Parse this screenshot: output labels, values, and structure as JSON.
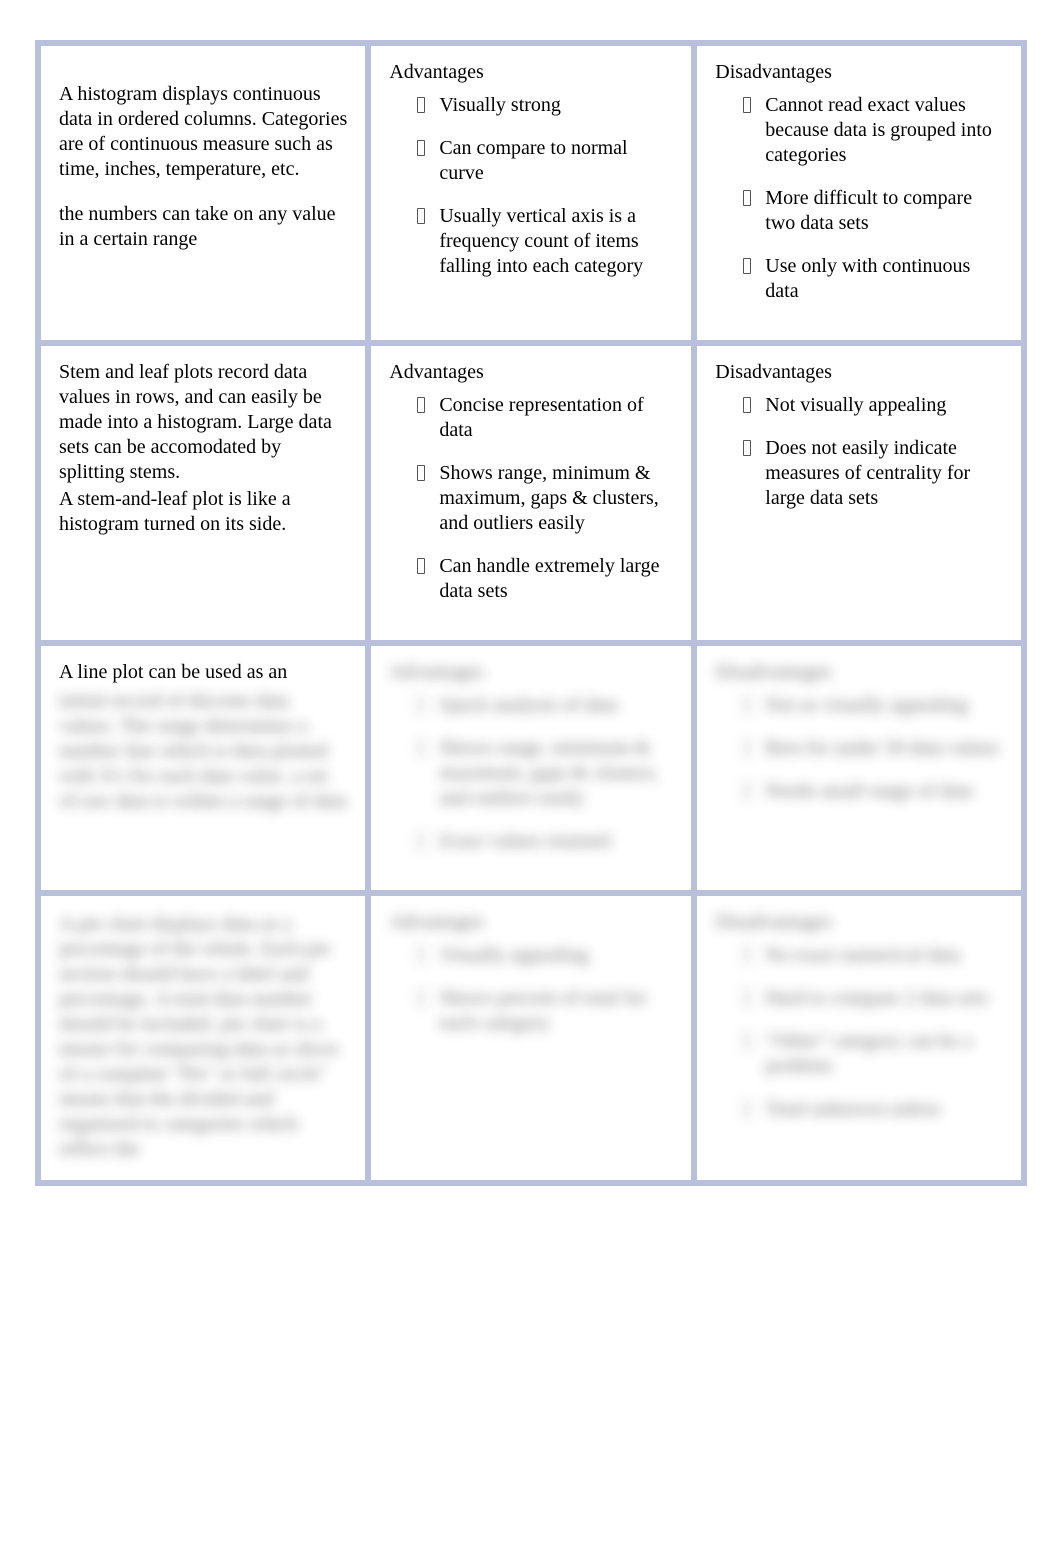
{
  "rows": [
    {
      "description": {
        "main": "A histogram displays continuous data in ordered columns. Categories are of continuous measure such as time, inches, temperature, etc.",
        "sub": "the numbers can take on any value in a certain range",
        "blurred": false
      },
      "advantages": {
        "heading": "Advantages",
        "items": [
          "Visually strong",
          "Can compare to normal curve",
          "Usually vertical axis is a frequency count of items falling into each category"
        ],
        "blurred": false
      },
      "disadvantages": {
        "heading": "Disadvantages",
        "items": [
          "Cannot read exact values because data is grouped into categories",
          "More difficult to compare two data sets",
          "Use only with continuous data"
        ],
        "blurred": false
      }
    },
    {
      "description": {
        "main": "Stem and leaf plots record data values in rows, and can easily be made into a histogram. Large data sets can be accomodated by splitting stems.",
        "sub": "A stem-and-leaf plot is like a histogram turned on its side.",
        "blurred": false
      },
      "advantages": {
        "heading": "Advantages",
        "items": [
          "Concise representation of data",
          "Shows range, minimum & maximum, gaps & clusters, and outliers easily",
          "Can handle extremely large data sets"
        ],
        "blurred": false
      },
      "disadvantages": {
        "heading": "Disadvantages",
        "items": [
          "Not visually appealing",
          "Does not easily indicate measures of centrality for large data sets"
        ],
        "blurred": false
      }
    },
    {
      "description": {
        "main": "A line plot can be used as an",
        "sub": "initial record of discrete data values. The range determines a number line which is then plotted with X's for each data value.  a set of raw data is within a range of data",
        "blurred": true,
        "firstLineClear": true
      },
      "advantages": {
        "heading": "Advantages",
        "items": [
          "Quick analysis of data",
          "Shows range, minimum & maximum, gaps & clusters, and outliers easily",
          "Exact values retained"
        ],
        "blurred": true
      },
      "disadvantages": {
        "heading": "Disadvantages",
        "items": [
          "Not as visually appealing",
          "Best for under 50 data values",
          "Needs small range of data"
        ],
        "blurred": true
      }
    },
    {
      "description": {
        "main": "",
        "sub": "A pie chart displays data as a percentage of the whole. Each pie section should have a label and percentage. A total data number should be included.\npie chart is a means for comparing data as slices of a complete \"Pie\" or full circle\" means that the divided and organized to categories which reflect the",
        "blurred": true
      },
      "advantages": {
        "heading": "Advantages",
        "items": [
          "Visually appealing",
          "Shows percent of total for each category"
        ],
        "blurred": true
      },
      "disadvantages": {
        "heading": "Disadvantages",
        "items": [
          "No exact numerical data",
          "Hard to compare 2 data sets",
          "\"Other\" category can be a problem",
          "Total unknown unless"
        ],
        "blurred": true
      }
    }
  ]
}
